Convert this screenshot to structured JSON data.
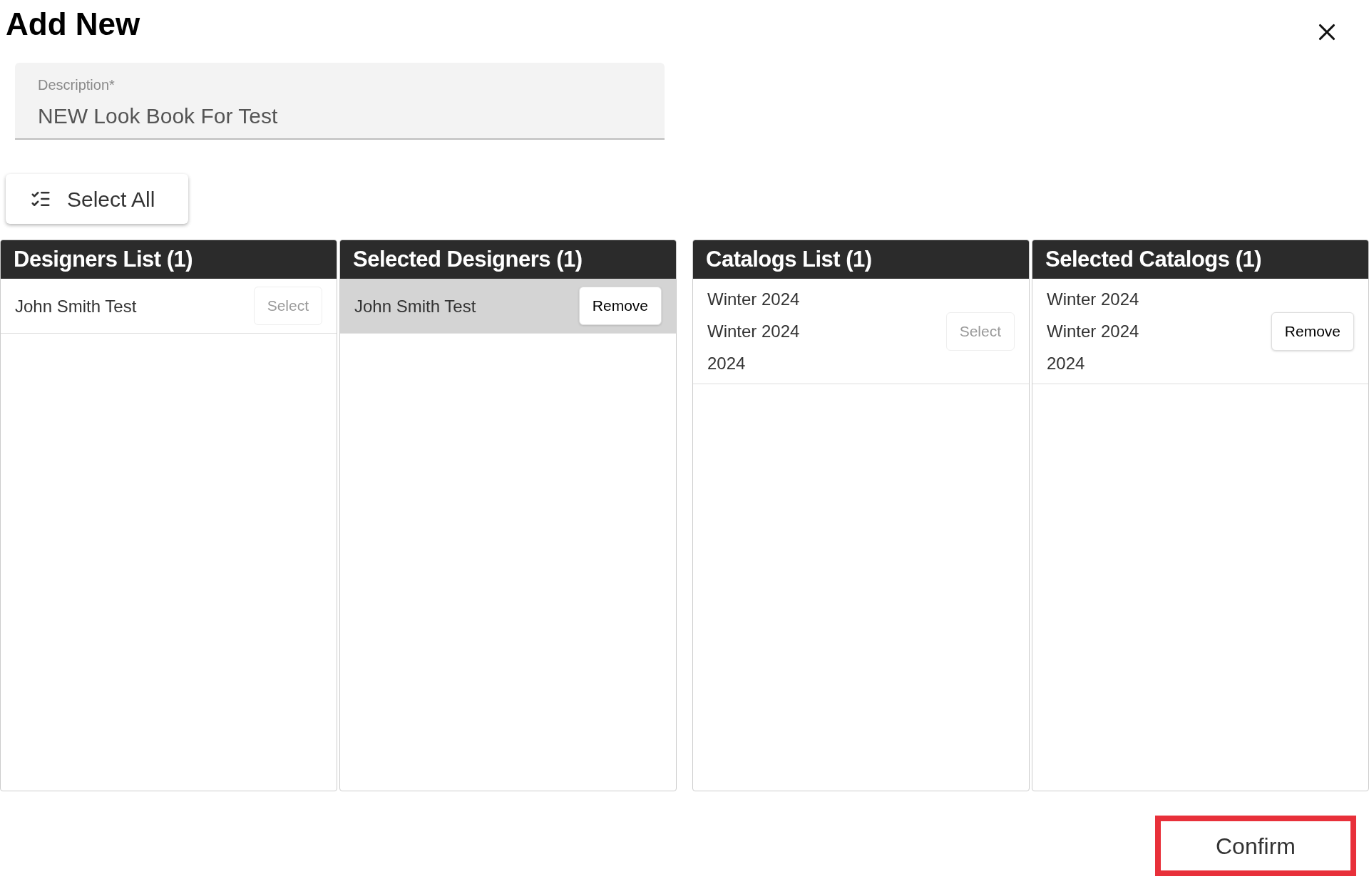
{
  "title": "Add New",
  "description_field": {
    "label": "Description*",
    "value": "NEW Look Book For Test"
  },
  "select_all_button": "Select All",
  "panel_groups": [
    {
      "panels": [
        {
          "title": "Designers List (1)",
          "items": [
            {
              "lines": [
                "John Smith Test"
              ],
              "action": "Select",
              "selected": false
            }
          ]
        },
        {
          "title": "Selected Designers (1)",
          "items": [
            {
              "lines": [
                "John Smith Test"
              ],
              "action": "Remove",
              "selected": true
            }
          ]
        }
      ]
    },
    {
      "panels": [
        {
          "title": "Catalogs List (1)",
          "items": [
            {
              "lines": [
                "Winter 2024",
                "Winter 2024",
                "2024"
              ],
              "action": "Select",
              "selected": false
            }
          ]
        },
        {
          "title": "Selected Catalogs (1)",
          "items": [
            {
              "lines": [
                "Winter 2024",
                "Winter 2024",
                "2024"
              ],
              "action": "Remove",
              "selected": false
            }
          ]
        }
      ]
    }
  ],
  "confirm_button": {
    "label": "Confirm",
    "highlighted": true
  }
}
